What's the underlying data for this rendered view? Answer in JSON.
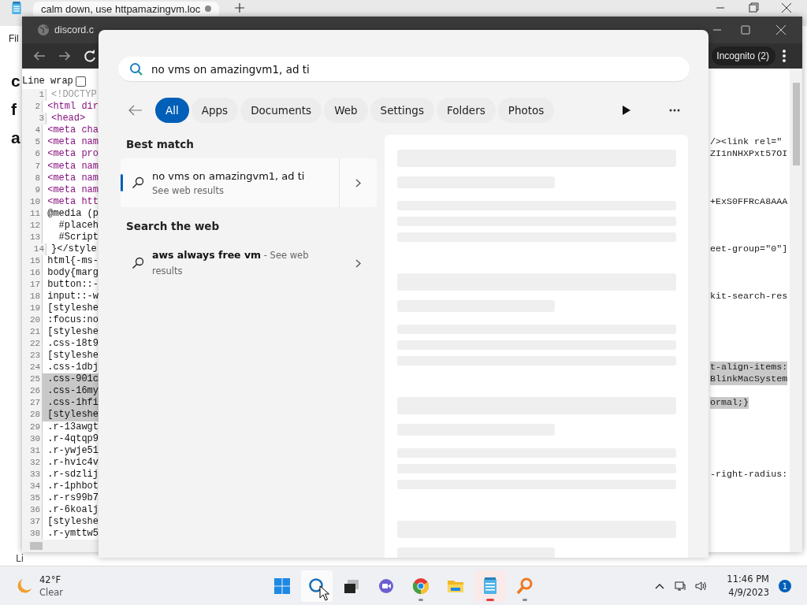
{
  "notepad": {
    "tab_title": "calm down, use httpamazingvm.loc",
    "modified": true,
    "menu": "Fil",
    "letters": [
      "c",
      "f",
      "a"
    ],
    "status": "Li"
  },
  "browser": {
    "tab_title": "discord.c",
    "profile": "Incognito (2)",
    "line_wrap": {
      "label": "Line wrap",
      "checked": false
    },
    "lines": [
      {
        "number": "1",
        "text": "<!DOCTYP",
        "kind": "doctype",
        "highlighted": false
      },
      {
        "number": "2",
        "text": "<html dir",
        "kind": "tag",
        "highlighted": false
      },
      {
        "number": "3",
        "text": "<head>",
        "kind": "tag",
        "highlighted": false
      },
      {
        "number": "4",
        "text": "<meta cha",
        "kind": "tag",
        "highlighted": false
      },
      {
        "number": "5",
        "text": "<meta nam",
        "kind": "tag",
        "highlighted": false,
        "right": "/><link rel=\"",
        "right_highlighted": false
      },
      {
        "number": "6",
        "text": "<meta pro",
        "kind": "tag",
        "highlighted": false,
        "right": "ZI1nNHXPxt57OI",
        "right_highlighted": false
      },
      {
        "number": "7",
        "text": "<meta nam",
        "kind": "tag",
        "highlighted": false
      },
      {
        "number": "8",
        "text": "<meta nam",
        "kind": "tag",
        "highlighted": false
      },
      {
        "number": "9",
        "text": "<meta nam",
        "kind": "tag",
        "highlighted": false
      },
      {
        "number": "10",
        "text": "<meta htt",
        "kind": "tag",
        "highlighted": false,
        "right": "+ExS0FFRcA8AAA",
        "right_highlighted": false
      },
      {
        "number": "11",
        "text": "@media (p",
        "kind": "code",
        "highlighted": false
      },
      {
        "number": "12",
        "text": "  #placeh",
        "kind": "code",
        "highlighted": false
      },
      {
        "number": "13",
        "text": "  #Script",
        "kind": "code",
        "highlighted": false
      },
      {
        "number": "14",
        "text": "}</style",
        "kind": "code",
        "highlighted": false,
        "right": "eet-group=\"0\"]",
        "right_highlighted": false
      },
      {
        "number": "15",
        "text": "html{-ms-",
        "kind": "code",
        "highlighted": false
      },
      {
        "number": "16",
        "text": "body{marg",
        "kind": "code",
        "highlighted": false
      },
      {
        "number": "17",
        "text": "button::-",
        "kind": "code",
        "highlighted": false
      },
      {
        "number": "18",
        "text": "input::-w",
        "kind": "code",
        "highlighted": false,
        "right": "kit-search-res",
        "right_highlighted": false
      },
      {
        "number": "19",
        "text": "[styleshe",
        "kind": "code",
        "highlighted": false
      },
      {
        "number": "20",
        "text": ":focus:no",
        "kind": "code",
        "highlighted": false
      },
      {
        "number": "21",
        "text": "[styleshe",
        "kind": "code",
        "highlighted": false
      },
      {
        "number": "22",
        "text": ".css-18t9",
        "kind": "code",
        "highlighted": false
      },
      {
        "number": "23",
        "text": "[styleshe",
        "kind": "code",
        "highlighted": false
      },
      {
        "number": "24",
        "text": ".css-1dbj",
        "kind": "code",
        "highlighted": false,
        "right": "t-align-items:",
        "right_highlighted": true
      },
      {
        "number": "25",
        "text": ".css-901c",
        "kind": "code",
        "highlighted": true,
        "right": "BlinkMacSystem",
        "right_highlighted": true
      },
      {
        "number": "26",
        "text": ".css-16my",
        "kind": "code",
        "highlighted": true
      },
      {
        "number": "27",
        "text": ".css-1hfi",
        "kind": "code",
        "highlighted": true,
        "right": "ormal;}",
        "right_highlighted": true
      },
      {
        "number": "28",
        "text": "[styleshe",
        "kind": "code",
        "highlighted": true
      },
      {
        "number": "29",
        "text": ".r-13awgt",
        "kind": "code",
        "highlighted": false
      },
      {
        "number": "30",
        "text": ".r-4qtqp9",
        "kind": "code",
        "highlighted": false
      },
      {
        "number": "31",
        "text": ".r-ywje51",
        "kind": "code",
        "highlighted": false
      },
      {
        "number": "32",
        "text": ".r-hvic4v",
        "kind": "code",
        "highlighted": false
      },
      {
        "number": "33",
        "text": ".r-sdzlij",
        "kind": "code",
        "highlighted": false,
        "right": "-right-radius:",
        "right_highlighted": false
      },
      {
        "number": "34",
        "text": ".r-1phbot",
        "kind": "code",
        "highlighted": false
      },
      {
        "number": "35",
        "text": ".r-rs99b7",
        "kind": "code",
        "highlighted": false
      },
      {
        "number": "36",
        "text": ".r-6koalj",
        "kind": "code",
        "highlighted": false
      },
      {
        "number": "37",
        "text": "[styleshe",
        "kind": "code",
        "highlighted": false
      },
      {
        "number": "38",
        "text": ".r-ymttw5",
        "kind": "code",
        "highlighted": false
      }
    ]
  },
  "search": {
    "query": "no vms on amazingvm1, ad ti",
    "filters": [
      {
        "label": "All",
        "selected": true
      },
      {
        "label": "Apps",
        "selected": false
      },
      {
        "label": "Documents",
        "selected": false
      },
      {
        "label": "Web",
        "selected": false
      },
      {
        "label": "Settings",
        "selected": false
      },
      {
        "label": "Folders",
        "selected": false
      },
      {
        "label": "Photos",
        "selected": false
      }
    ],
    "best_match_heading": "Best match",
    "best_match": {
      "title": "no vms on amazingvm1, ad ti",
      "subtitle": "See web results",
      "selected": true
    },
    "web_heading": "Search the web",
    "web_results": [
      {
        "title": "aws always free vm",
        "suffix": " - See web results"
      }
    ]
  },
  "taskbar": {
    "weather": {
      "temperature": "42°F",
      "condition": "Clear"
    },
    "apps": [
      {
        "kind": "start",
        "highlighted": false,
        "running": false,
        "attention": false
      },
      {
        "kind": "search",
        "highlighted": true,
        "running": false,
        "attention": false
      },
      {
        "kind": "taskview",
        "highlighted": false,
        "running": false,
        "attention": false
      },
      {
        "kind": "chat",
        "highlighted": false,
        "running": false,
        "attention": false
      },
      {
        "kind": "chrome",
        "highlighted": false,
        "running": true,
        "attention": false
      },
      {
        "kind": "explorer",
        "highlighted": false,
        "running": false,
        "attention": false
      },
      {
        "kind": "notepad",
        "highlighted": true,
        "running": true,
        "attention": true
      },
      {
        "kind": "magnifier",
        "highlighted": false,
        "running": true,
        "attention": false
      }
    ],
    "time": "11:46 PM",
    "date": "4/9/2023",
    "notifications": "1"
  }
}
